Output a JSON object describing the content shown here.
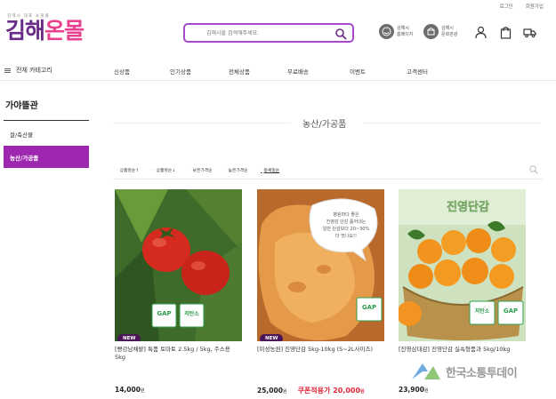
{
  "utility": {
    "login": "로그인",
    "join": "회원가입"
  },
  "logo": {
    "tagline": "김해시 대표 쇼핑몰",
    "part1": "김해",
    "part2": "온몰"
  },
  "search": {
    "placeholder": "김해시를 검색해주세요."
  },
  "quick_links": [
    {
      "icon": "smile-icon",
      "line1": "김해시",
      "line2": "홈페이지"
    },
    {
      "icon": "building-icon",
      "line1": "김해시",
      "line2": "문화관광"
    }
  ],
  "header_icons": [
    "user-icon",
    "bag-icon",
    "truck-icon"
  ],
  "nav": {
    "category_label": "전체 카테고리",
    "items": [
      "신상품",
      "인기상품",
      "전체상품",
      "무료배송",
      "이벤트",
      "고객센터"
    ]
  },
  "sidebar": {
    "title": "가야뜰관",
    "items": [
      {
        "label": "쌀/축산물",
        "active": false
      },
      {
        "label": "농산/가공품",
        "active": true
      }
    ]
  },
  "section": {
    "title": "농산/가공품"
  },
  "sort": {
    "options": [
      "상품명순↑",
      "상품명순↓",
      "낮은가격순",
      "높은가격순",
      "등록일순"
    ],
    "selected_index": 4
  },
  "products": [
    {
      "name": "[빵강남채밭] 특품 토마토 2.5kg / 5kg, 주스용 5kg",
      "badge": "NEW",
      "price": "14,000",
      "unit": "원",
      "coupon": "",
      "coupon_unit": ""
    },
    {
      "name": "[미성농원] 진영단감 5kg-10kg (S~2L사이즈)",
      "badge": "NEW",
      "price": "25,000",
      "unit": "원",
      "coupon": "쿠폰적용가 20,000",
      "coupon_unit": "원"
    },
    {
      "name": "[진영삼대감] 진영단감 실속형품과 5kg/10kg",
      "badge": "",
      "price": "23,900",
      "unit": "원",
      "coupon": "",
      "coupon_unit": ""
    }
  ],
  "product_labels": {
    "gap": "GAP",
    "low_carbon": "저탄소",
    "persimmon_banner": "진영단감",
    "persimmon_text": [
      "병원마다 좋은",
      "진영감 단감 품어내는",
      "일반 단감보다 20~30%",
      "더 맛나요!!"
    ]
  },
  "watermark": {
    "text": "한국소통투데이"
  },
  "colors": {
    "brand_purple": "#6a2a87",
    "brand_pink": "#e8418f",
    "active": "#9e27b0",
    "coupon_red": "#e0283a"
  }
}
